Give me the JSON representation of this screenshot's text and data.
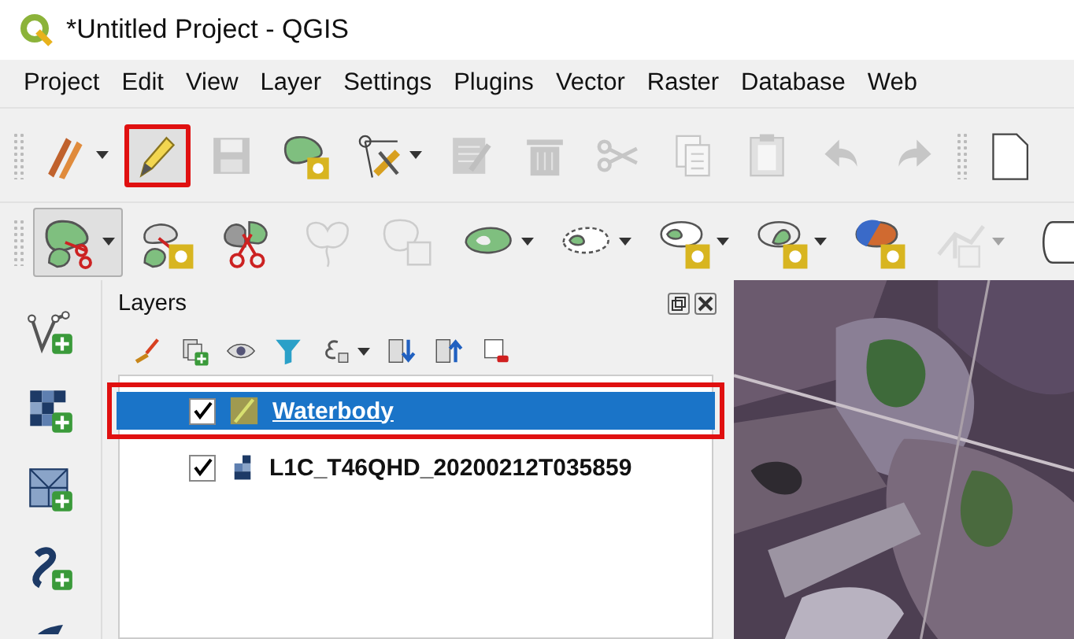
{
  "window": {
    "title": "*Untitled Project - QGIS"
  },
  "menu": [
    {
      "label": "Project"
    },
    {
      "label": "Edit"
    },
    {
      "label": "View"
    },
    {
      "label": "Layer"
    },
    {
      "label": "Settings"
    },
    {
      "label": "Plugins"
    },
    {
      "label": "Vector"
    },
    {
      "label": "Raster"
    },
    {
      "label": "Database"
    },
    {
      "label": "Web"
    }
  ],
  "toolbars": [
    {
      "items": [
        {
          "kind": "button",
          "disabled": false,
          "dropdown": true,
          "pressed": false,
          "highlighted": false
        },
        {
          "kind": "button",
          "disabled": false,
          "dropdown": false,
          "pressed": true,
          "highlighted": true
        },
        {
          "kind": "button",
          "disabled": true,
          "dropdown": false,
          "pressed": false,
          "highlighted": false
        },
        {
          "kind": "button",
          "disabled": false,
          "dropdown": false,
          "pressed": false,
          "highlighted": false
        },
        {
          "kind": "button",
          "disabled": false,
          "dropdown": true,
          "pressed": false,
          "highlighted": false
        },
        {
          "kind": "button",
          "disabled": true,
          "dropdown": false,
          "pressed": false,
          "highlighted": false
        },
        {
          "kind": "button",
          "disabled": true,
          "dropdown": false,
          "pressed": false,
          "highlighted": false
        },
        {
          "kind": "button",
          "disabled": true,
          "dropdown": false,
          "pressed": false,
          "highlighted": false
        },
        {
          "kind": "button",
          "disabled": true,
          "dropdown": false,
          "pressed": false,
          "highlighted": false
        },
        {
          "kind": "button",
          "disabled": true,
          "dropdown": false,
          "pressed": false,
          "highlighted": false
        },
        {
          "kind": "button",
          "disabled": true,
          "dropdown": false,
          "pressed": false,
          "highlighted": false
        },
        {
          "kind": "button",
          "disabled": true,
          "dropdown": false,
          "pressed": false,
          "highlighted": false
        },
        {
          "kind": "separator"
        },
        {
          "kind": "button",
          "disabled": false,
          "dropdown": false,
          "pressed": false,
          "highlighted": false
        }
      ]
    },
    {
      "items": [
        {
          "kind": "button",
          "disabled": false,
          "dropdown": true,
          "pressed": true,
          "highlighted": false
        },
        {
          "kind": "button",
          "disabled": false,
          "dropdown": false,
          "pressed": false,
          "highlighted": false
        },
        {
          "kind": "button",
          "disabled": false,
          "dropdown": false,
          "pressed": false,
          "highlighted": false
        },
        {
          "kind": "button",
          "disabled": true,
          "dropdown": false,
          "pressed": false,
          "highlighted": false
        },
        {
          "kind": "button",
          "disabled": true,
          "dropdown": false,
          "pressed": false,
          "highlighted": false
        },
        {
          "kind": "button",
          "disabled": false,
          "dropdown": true,
          "pressed": false,
          "highlighted": false
        },
        {
          "kind": "button",
          "disabled": false,
          "dropdown": true,
          "pressed": false,
          "highlighted": false
        },
        {
          "kind": "button",
          "disabled": false,
          "dropdown": true,
          "pressed": false,
          "highlighted": false
        },
        {
          "kind": "button",
          "disabled": false,
          "dropdown": true,
          "pressed": false,
          "highlighted": false
        },
        {
          "kind": "button",
          "disabled": false,
          "dropdown": false,
          "pressed": false,
          "highlighted": false
        },
        {
          "kind": "button",
          "disabled": true,
          "dropdown": true,
          "pressed": false,
          "highlighted": false
        },
        {
          "kind": "button",
          "disabled": false,
          "dropdown": false,
          "pressed": false,
          "highlighted": false
        }
      ]
    }
  ],
  "layers_panel": {
    "title": "Layers",
    "layers": [
      {
        "name": "Waterbody",
        "kind": "vector",
        "checked": true,
        "selected": true,
        "editing": true,
        "highlighted": true
      },
      {
        "name": "L1C_T46QHD_20200212T035859",
        "kind": "raster",
        "checked": true,
        "selected": false,
        "editing": false,
        "highlighted": false
      }
    ]
  }
}
